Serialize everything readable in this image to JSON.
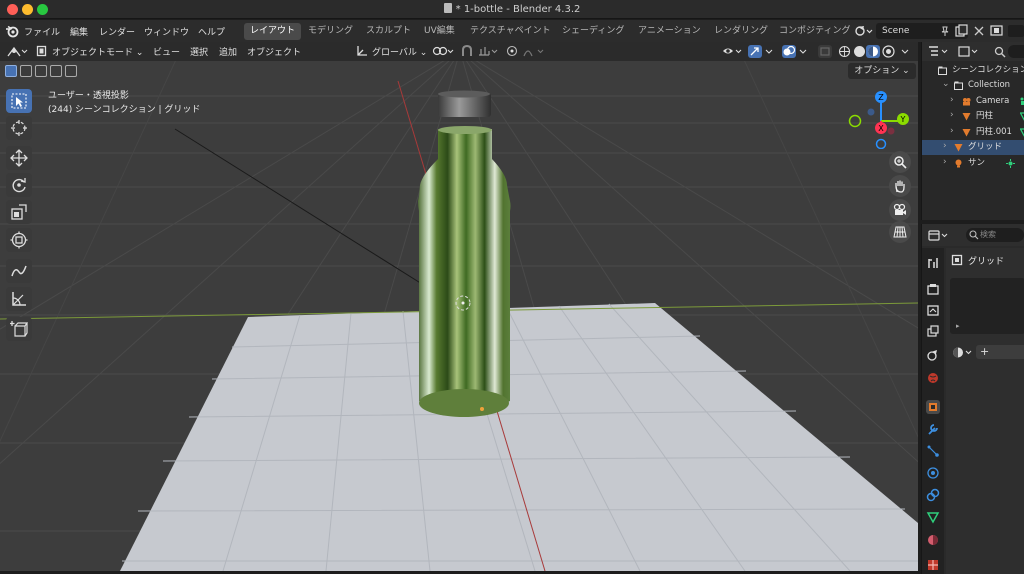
{
  "window": {
    "title": "* 1-bottle - Blender 4.3.2",
    "traffic_lights": {
      "close": "#ff5f57",
      "minimize": "#febc2e",
      "maximize": "#28c840"
    }
  },
  "menu": {
    "items": [
      "ファイル",
      "編集",
      "レンダー",
      "ウィンドウ",
      "ヘルプ"
    ]
  },
  "workspaces": {
    "tabs": [
      "レイアウト",
      "モデリング",
      "スカルプト",
      "UV編集",
      "テクスチャペイント",
      "シェーディング",
      "アニメーション",
      "レンダリング",
      "コンポジティング"
    ],
    "active": "レイアウト"
  },
  "scene": {
    "name": "Scene"
  },
  "viewport_header": {
    "mode": "オブジェクトモード",
    "menus": [
      "ビュー",
      "選択",
      "追加",
      "オブジェクト"
    ],
    "transform_orientation": "グローバル"
  },
  "tool_settings": {
    "options_label": "オプション"
  },
  "viewport": {
    "view_name": "ユーザー・透視投影",
    "collection_info": "(244) シーンコレクション | グリッド",
    "gizmo_axes": {
      "x": "X",
      "y": "Y",
      "z": "Z"
    },
    "colors": {
      "x": "#ff3352",
      "y": "#8bdc00",
      "z": "#2890ff",
      "background": "#3d3d3d",
      "plane": "#c5c8ce"
    }
  },
  "toolbar": {
    "tools": [
      "select-box",
      "cursor",
      "move",
      "rotate",
      "scale",
      "transform",
      "annotate",
      "measure",
      "add-cube"
    ],
    "active": "select-box"
  },
  "outliner": {
    "root": "シーンコレクション",
    "items": [
      {
        "name": "Collection",
        "icon": "collection-icon",
        "depth": 1
      },
      {
        "name": "Camera",
        "icon": "camera-icon",
        "depth": 2
      },
      {
        "name": "円柱",
        "icon": "mesh-icon",
        "depth": 2
      },
      {
        "name": "円柱.001",
        "icon": "mesh-icon",
        "depth": 2
      },
      {
        "name": "グリッド",
        "icon": "mesh-icon",
        "depth": 1,
        "selected": true
      },
      {
        "name": "サン",
        "icon": "light-icon",
        "depth": 1
      }
    ]
  },
  "properties": {
    "search_placeholder": "検索",
    "object_name": "グリッド",
    "add_label": "+"
  }
}
